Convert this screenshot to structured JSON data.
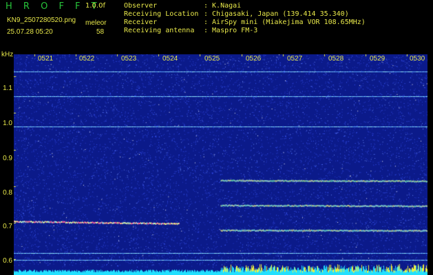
{
  "header": {
    "title": "H R O F F T",
    "version": "1.0.0f",
    "filename": "KN9_2507280520.png",
    "timestamp": "25.07.28 05:20",
    "meteor_label": "meleor",
    "meteor_count": "58"
  },
  "info": [
    {
      "key": "Observer",
      "value": ": K.Nagai"
    },
    {
      "key": "Receiving Location",
      "value": ": Chigasaki, Japan (139.414 35.340)"
    },
    {
      "key": "Receiver",
      "value": ": AirSpy mini (Miakejima VOR 108.65MHz)"
    },
    {
      "key": "Receiving antenna",
      "value": ": Maspro FM-3"
    }
  ],
  "axis": {
    "unit": "kHz",
    "y_ticks": [
      "1.1",
      "1.0",
      "0.9",
      "0.8",
      "0.7",
      "0.6"
    ],
    "x_ticks": [
      "0521",
      "0522",
      "0523",
      "0524",
      "0525",
      "0526",
      "0527",
      "0528",
      "0529",
      "0530"
    ]
  },
  "spectrogram": {
    "background_color": "#0b1a8a",
    "noise_color": "#3d5bff",
    "carrier_color": "#8fe8ff",
    "tick_color": "#e8e84a",
    "y_range_khz": [
      0.58,
      1.16
    ],
    "x_range_min": [
      0,
      10
    ],
    "carriers_khz": [
      1.113,
      1.046,
      0.962,
      0.618,
      0.598
    ],
    "signals": [
      {
        "t0": 0,
        "t1": 4.0,
        "f0": 0.703,
        "f1": 0.697,
        "color": "#ff6aa0"
      },
      {
        "t0": 5.0,
        "t1": 10,
        "f0": 0.815,
        "f1": 0.813,
        "color": "#7cffb0"
      },
      {
        "t0": 5.0,
        "t1": 10,
        "f0": 0.747,
        "f1": 0.745,
        "color": "#7cffd8"
      },
      {
        "t0": 5.0,
        "t1": 10,
        "f0": 0.679,
        "f1": 0.678,
        "color": "#7cffd8"
      }
    ]
  }
}
